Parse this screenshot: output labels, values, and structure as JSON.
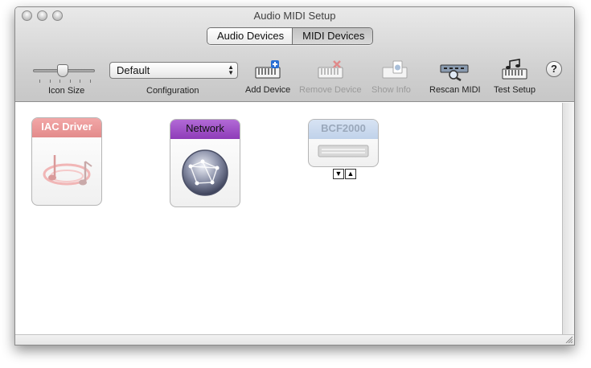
{
  "window": {
    "title": "Audio MIDI Setup"
  },
  "tabs": [
    {
      "label": "Audio Devices",
      "selected": false
    },
    {
      "label": "MIDI Devices",
      "selected": true
    }
  ],
  "toolbar": {
    "icon_size_label": "Icon Size",
    "configuration_label": "Configuration",
    "configuration_value": "Default",
    "add_device_label": "Add Device",
    "remove_device_label": "Remove Device",
    "show_info_label": "Show Info",
    "rescan_midi_label": "Rescan MIDI",
    "test_setup_label": "Test Setup",
    "help_label": "?",
    "icon_size_value": 0.5
  },
  "devices": [
    {
      "name": "IAC Driver",
      "color": "#e38b8b",
      "icon": "music-notes-icon",
      "enabled": false
    },
    {
      "name": "Network",
      "color": "#8e3cb8",
      "icon": "globe-icon",
      "enabled": true
    },
    {
      "name": "BCF2000",
      "color": "#c0d2ea",
      "icon": "mixer-controller-icon",
      "enabled": false
    }
  ],
  "colors": {
    "accent_network": "#8e3cb8",
    "iac": "#e38b8b",
    "bcf": "#c0d2ea"
  }
}
